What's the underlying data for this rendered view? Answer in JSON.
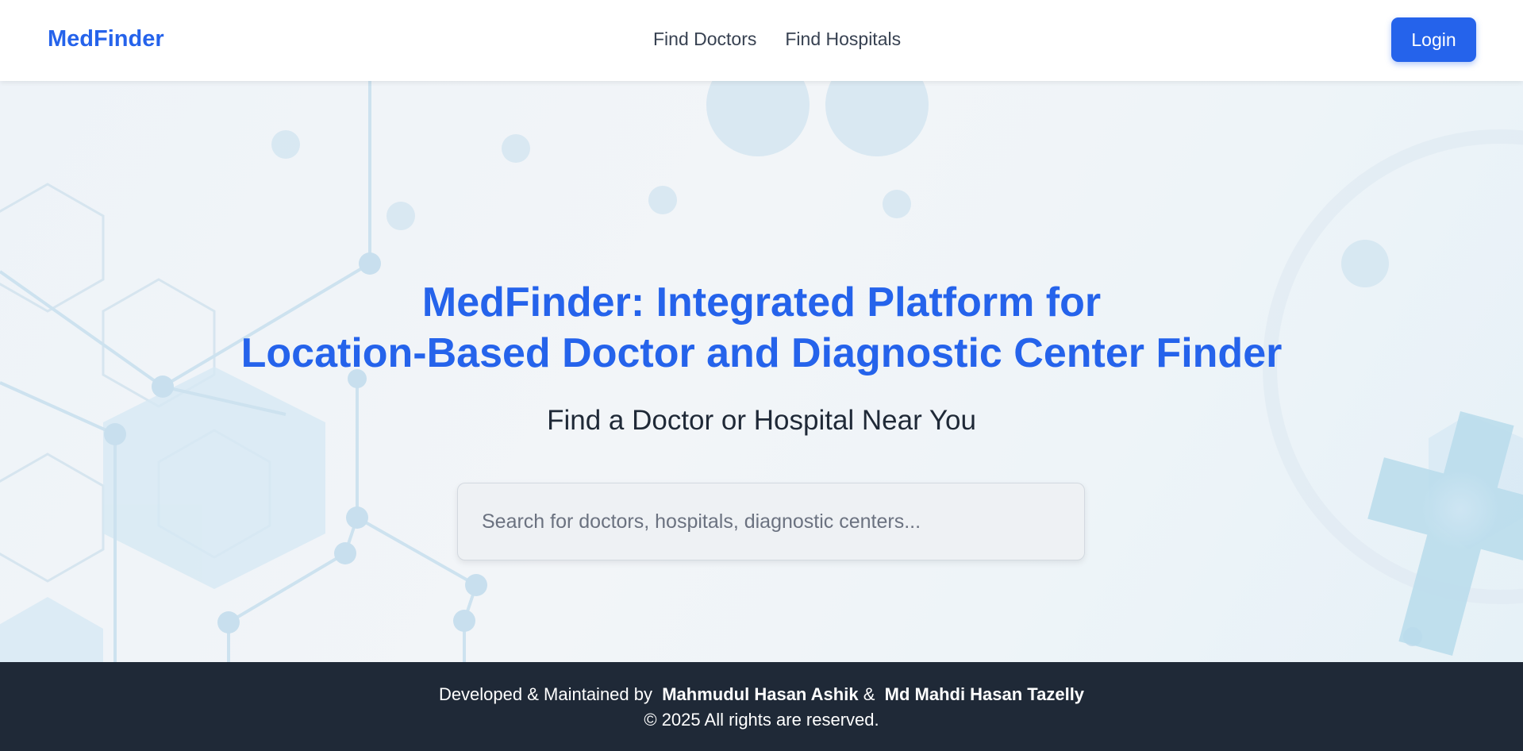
{
  "header": {
    "brand": "MedFinder",
    "nav": [
      {
        "label": "Find Doctors"
      },
      {
        "label": "Find Hospitals"
      }
    ],
    "login_label": "Login"
  },
  "hero": {
    "title_line1": "MedFinder: Integrated Platform for",
    "title_line2": "Location-Based Doctor and Diagnostic Center Finder",
    "subtitle": "Find a Doctor or Hospital Near You",
    "search": {
      "placeholder": "Search for doctors, hospitals, diagnostic centers...",
      "value": ""
    }
  },
  "footer": {
    "prefix": "Developed & Maintained by",
    "developer1": "Mahmudul Hasan Ashik",
    "separator": "&",
    "developer2": "Md Mahdi Hasan Tazelly",
    "copyright": "© 2025 All rights are reserved."
  },
  "colors": {
    "accent": "#2563eb",
    "footer_bg": "#1f2937",
    "header_bg": "#ffffff"
  }
}
